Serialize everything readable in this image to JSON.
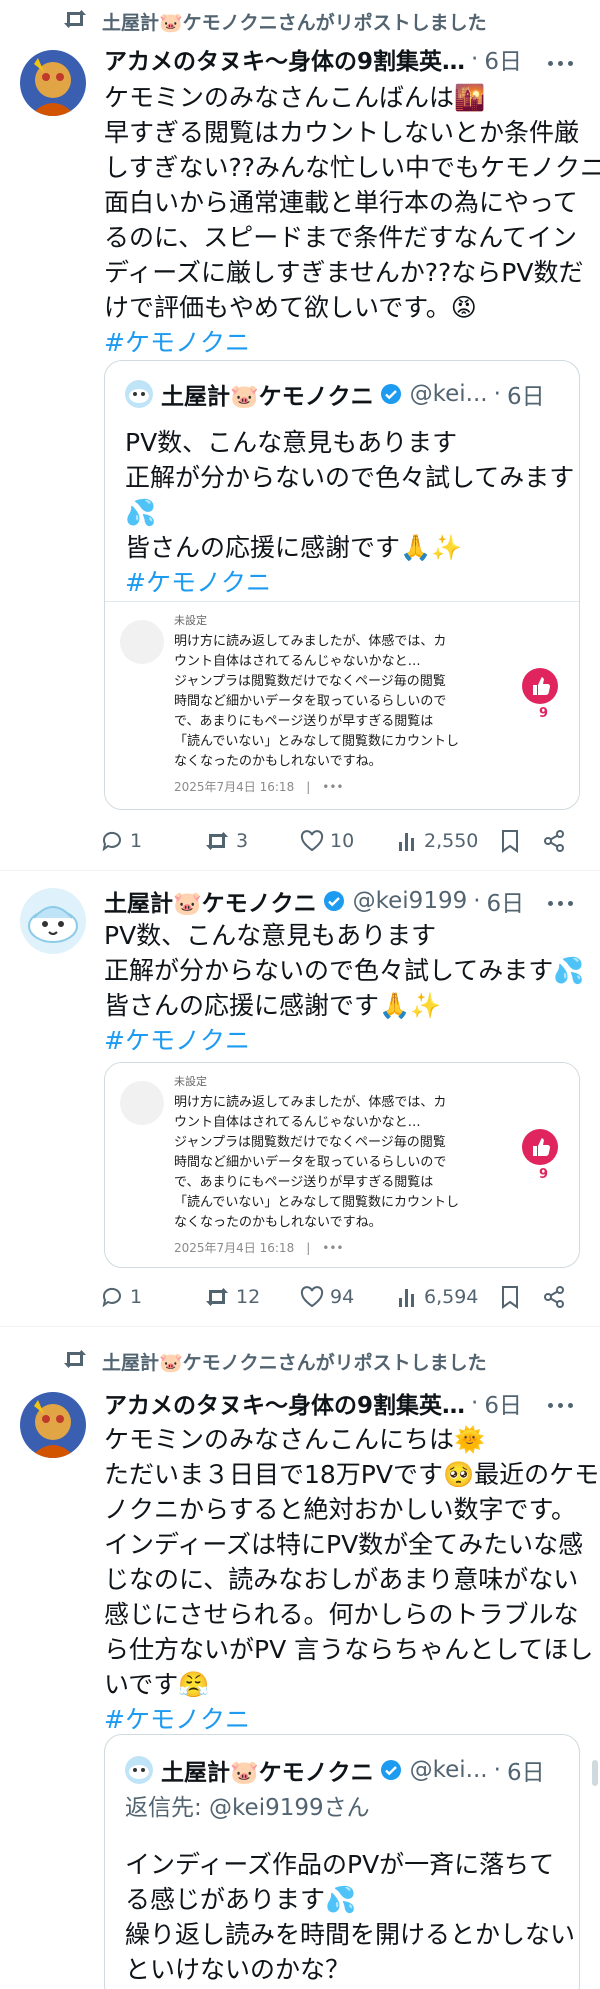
{
  "colors": {
    "accent": "#1d9bf0",
    "muted": "#536471",
    "text": "#0f1419",
    "like_red": "#e0245e"
  },
  "tweets": [
    {
      "repost_text": "土屋計🐷ケモノクニさんがリポストしました",
      "author_name": "アカメのタヌキ〜身体の9割集英…",
      "time": "6日",
      "lines": [
        "ケモミンのみなさんこんばんは🌇",
        "早すぎる閲覧はカウントしないとか条件厳",
        "しすぎない??みんな忙しい中でもケモノクニ",
        "面白いから通常連載と単行本の為にやって",
        "るのに、スピードまで条件だすなんてイン",
        "ディーズに厳しすぎませんか??ならPV数だ",
        "けで評価もやめて欲しいです。😡"
      ],
      "hashtag": "#ケモノクニ",
      "quote": {
        "author_name": "土屋計🐷ケモノクニ",
        "handle": "@kei...",
        "time": "6日",
        "lines": [
          "PV数、こんな意見もあります",
          "正解が分からないので色々試してみます",
          "💦",
          "皆さんの応援に感謝です🙏✨"
        ],
        "hashtag": "#ケモノクニ",
        "embed": {
          "tag": "未設定",
          "lines": [
            "明け方に読み返してみましたが、体感では、カ",
            "ウント自体はされてるんじゃないかなと…",
            "ジャンプラは閲覧数だけでなくページ毎の閲覧",
            "時間など細かいデータを取っているらしいので",
            "で、あまりにもページ送りが早すぎる閲覧は",
            "「読んでいない」とみなして閲覧数にカウントし",
            "なくなったのかもしれないですね。"
          ],
          "date": "2025年7月4日 16:18　|　•••",
          "likes": "9"
        }
      },
      "actions": {
        "replies": "1",
        "reposts": "3",
        "likes": "10",
        "views": "2,550"
      }
    },
    {
      "author_name": "土屋計🐷ケモノクニ",
      "handle": "@kei9199",
      "time": "6日",
      "lines": [
        "PV数、こんな意見もあります",
        "正解が分からないので色々試してみます💦",
        "皆さんの応援に感謝です🙏✨"
      ],
      "hashtag": "#ケモノクニ",
      "embed": {
        "tag": "未設定",
        "lines": [
          "明け方に読み返してみましたが、体感では、カ",
          "ウント自体はされてるんじゃないかなと…",
          "ジャンプラは閲覧数だけでなくページ毎の閲覧",
          "時間など細かいデータを取っているらしいので",
          "で、あまりにもページ送りが早すぎる閲覧は",
          "「読んでいない」とみなして閲覧数にカウントし",
          "なくなったのかもしれないですね。"
        ],
        "date": "2025年7月4日 16:18　|　•••",
        "likes": "9"
      },
      "actions": {
        "replies": "1",
        "reposts": "12",
        "likes": "94",
        "views": "6,594"
      }
    },
    {
      "repost_text": "土屋計🐷ケモノクニさんがリポストしました",
      "author_name": "アカメのタヌキ〜身体の9割集英…",
      "time": "6日",
      "lines": [
        "ケモミンのみなさんこんにちは🌞",
        "ただいま３日目で18万PVです🥺最近のケモ",
        "ノクニからすると絶対おかしい数字です。",
        "インディーズは特にPV数が全てみたいな感",
        "じなのに、読みなおしがあまり意味がない",
        "感じにさせられる。何かしらのトラブルな",
        "ら仕方ないがPV 言うならちゃんとしてほし",
        "いです😤"
      ],
      "hashtag": "#ケモノクニ",
      "quote": {
        "author_name": "土屋計🐷ケモノクニ",
        "handle": "@kei...",
        "time": "6日",
        "reply_to": "返信先: @kei9199さん",
        "lines": [
          "インディーズ作品のPVが一斉に落ちて",
          "る感じがあります💦",
          "繰り返し読みを時間を開けるとかしない",
          "といけないのかな？"
        ]
      }
    }
  ]
}
